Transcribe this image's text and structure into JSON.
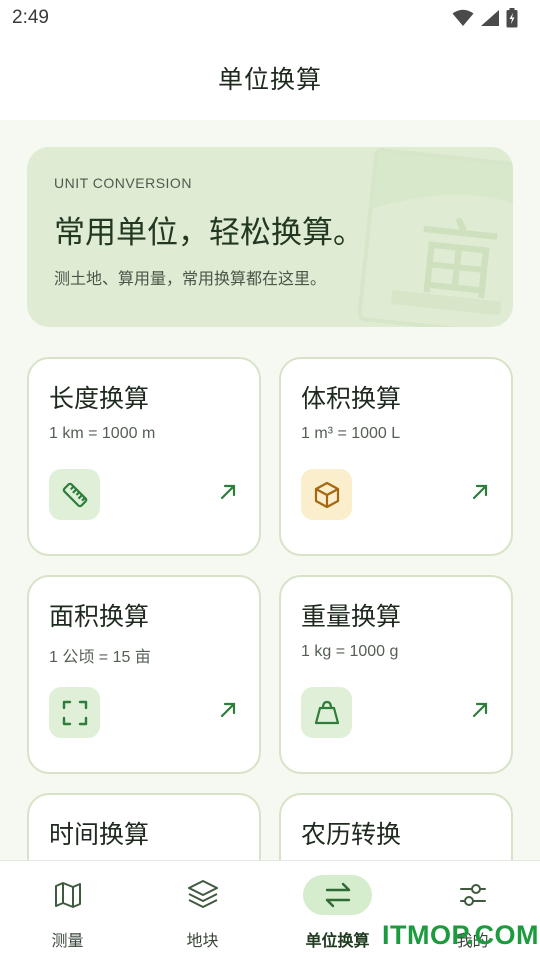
{
  "status_bar": {
    "time": "2:49",
    "icons": [
      "wifi-icon",
      "signal-icon",
      "battery-charging-icon"
    ]
  },
  "app_bar": {
    "title": "单位换算"
  },
  "hero": {
    "eyebrow": "UNIT CONVERSION",
    "title": "常用单位，轻松换算。",
    "subtitle": "测土地、算用量，常用换算都在这里。",
    "watermark_glyph": "亩"
  },
  "cards": [
    {
      "title": "长度换算",
      "formula": "1 km = 1000 m",
      "icon": "ruler-icon",
      "icon_bg": "#e0efd8"
    },
    {
      "title": "体积换算",
      "formula": "1 m³ = 1000 L",
      "icon": "cube-icon",
      "icon_bg": "#faeecc"
    },
    {
      "title": "面积换算",
      "formula": "1 公顷 = 15 亩",
      "icon": "area-frame-icon",
      "icon_bg": "#e0efd8"
    },
    {
      "title": "重量换算",
      "formula": "1 kg = 1000 g",
      "icon": "weight-icon",
      "icon_bg": "#e0efd8"
    },
    {
      "title": "时间换算",
      "formula": "",
      "icon": ""
    },
    {
      "title": "农历转换",
      "formula": "",
      "icon": ""
    }
  ],
  "bottom_nav": [
    {
      "label": "测量",
      "icon": "map-icon",
      "active": false
    },
    {
      "label": "地块",
      "icon": "layers-icon",
      "active": false
    },
    {
      "label": "单位换算",
      "icon": "swap-icon",
      "active": true
    },
    {
      "label": "我的",
      "icon": "settings-sliders-icon",
      "active": false
    }
  ],
  "watermark": "ITMOP.COM",
  "colors": {
    "accent": "#2e7d3a",
    "hero_bg": "#dfecd3",
    "card_border": "#d7e3c7",
    "active_nav_bg": "#d5eccd"
  }
}
